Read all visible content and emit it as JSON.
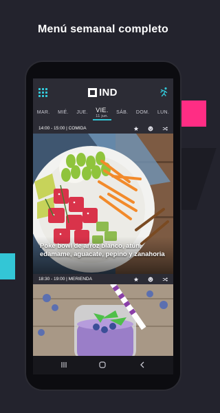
{
  "headline": "Menú semanal completo",
  "app": {
    "logo_text": "IND"
  },
  "days": [
    {
      "label": "MAR.",
      "active": false
    },
    {
      "label": "MIÉ.",
      "active": false
    },
    {
      "label": "JUE.",
      "active": false
    },
    {
      "label": "VIE.",
      "sub": "11 jun.",
      "active": true
    },
    {
      "label": "SÁB.",
      "active": false
    },
    {
      "label": "DOM.",
      "active": false
    },
    {
      "label": "LUN.",
      "active": false
    }
  ],
  "meals": [
    {
      "time_label": "14:00 - 15:00  |  COMIDA",
      "dish": "Poke bowl de arroz blanco, atún, edamame, aguacate, pepino y zanahoria"
    },
    {
      "time_label": "18:30 - 19:00  |  MERIENDA"
    }
  ],
  "colors": {
    "accent": "#33c6d6",
    "pink": "#ff2d84",
    "background": "#23232d",
    "screen": "#2c2c35"
  },
  "icons": [
    "grid-icon",
    "runner-icon",
    "star-add-icon",
    "smiley-icon",
    "shuffle-icon",
    "recents-icon",
    "home-icon",
    "back-icon"
  ]
}
